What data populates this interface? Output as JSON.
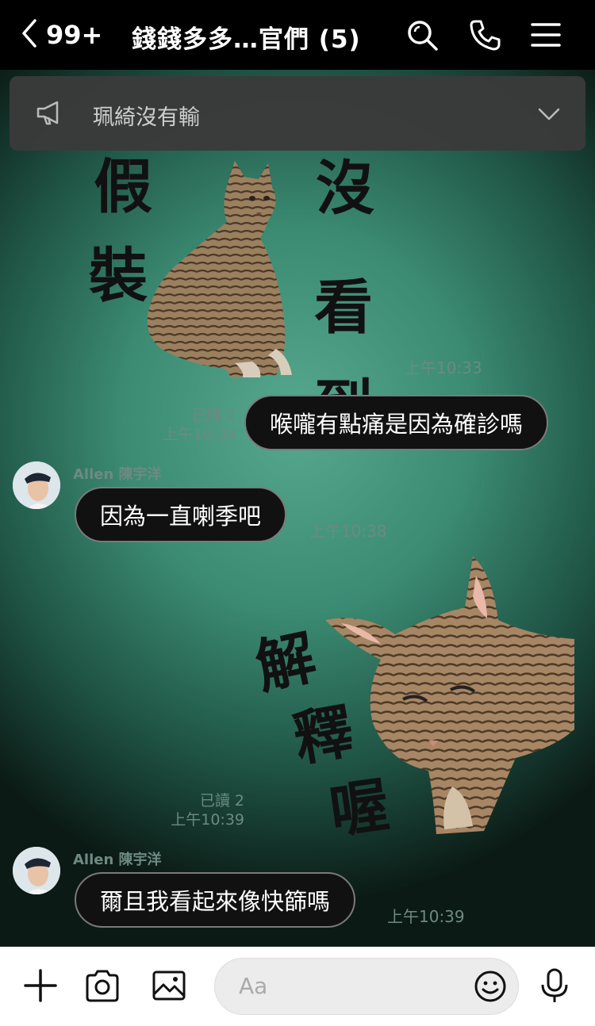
{
  "header": {
    "back_count": "99+",
    "title": "錢錢多多…官們 (5)"
  },
  "announcement": {
    "text": "珮綺沒有輸"
  },
  "messages": [
    {
      "type": "sticker",
      "side": "left",
      "text_chars": [
        "假",
        "裝",
        "沒",
        "看",
        "到"
      ],
      "time": "上午10:33"
    },
    {
      "type": "text",
      "side": "right",
      "text": "喉嚨有點痛是因為確診嗎",
      "read": "已讀 2",
      "time": "上午10:38"
    },
    {
      "type": "text",
      "side": "left",
      "sender": "Allen 陳宇洋",
      "text": "因為一直喇季吧",
      "time": "上午10:38"
    },
    {
      "type": "sticker",
      "side": "right",
      "text_chars": [
        "解",
        "釋",
        "喔"
      ],
      "read": "已讀 2",
      "time": "上午10:39"
    },
    {
      "type": "text",
      "side": "left",
      "sender": "Allen 陳宇洋",
      "text": "爾且我看起來像快篩嗎",
      "time": "上午10:39"
    }
  ],
  "footer": {
    "input_placeholder": "Aa"
  },
  "icons": {
    "back": "chevron-left-icon",
    "search": "search-icon",
    "call": "phone-icon",
    "menu": "menu-icon",
    "announce": "megaphone-icon",
    "expand": "chevron-down-icon",
    "plus": "plus-icon",
    "camera": "camera-icon",
    "image": "image-icon",
    "emoji": "emoji-icon",
    "mic": "microphone-icon"
  },
  "colors": {
    "header_bg": "#000000",
    "chat_bg": "#4d9f86",
    "bubble_bg": "#111111",
    "footer_bg": "#ffffff"
  }
}
